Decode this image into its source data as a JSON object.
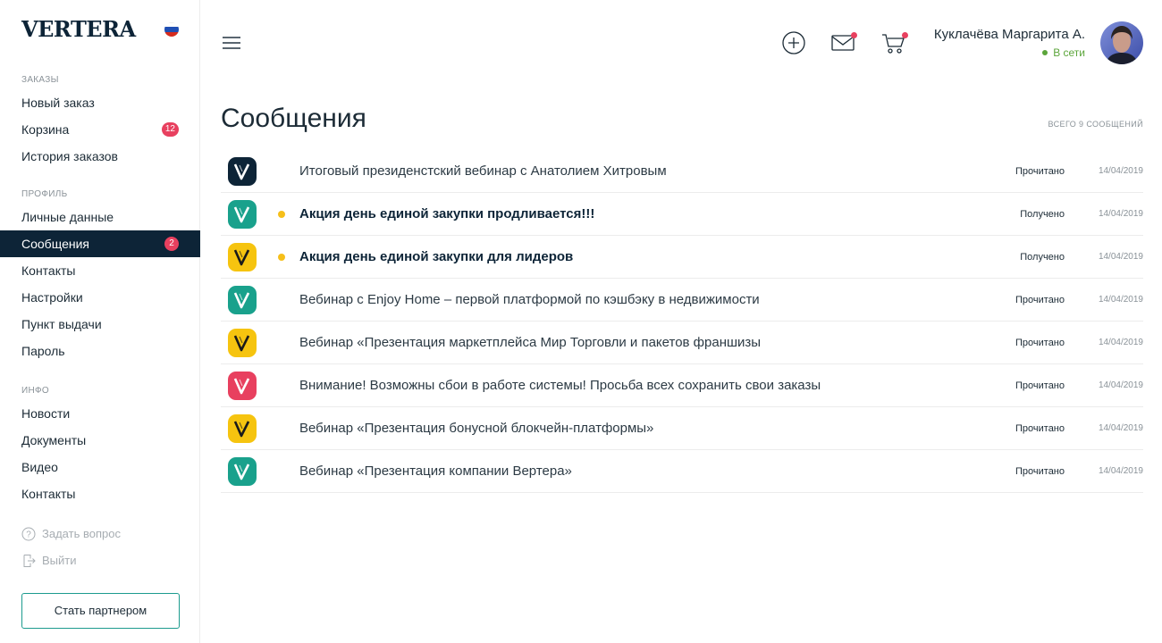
{
  "brand": {
    "logo": "VERTERA"
  },
  "sidebar": {
    "sections": [
      {
        "title": "ЗАКАЗЫ",
        "items": [
          {
            "label": "Новый заказ"
          },
          {
            "label": "Корзина",
            "badge": "12"
          },
          {
            "label": "История заказов"
          }
        ]
      },
      {
        "title": "ПРОФИЛЬ",
        "items": [
          {
            "label": "Личные данные"
          },
          {
            "label": "Сообщения",
            "badge": "2",
            "active": true
          },
          {
            "label": "Контакты"
          },
          {
            "label": "Настройки"
          },
          {
            "label": "Пункт выдачи"
          },
          {
            "label": "Пароль"
          }
        ]
      },
      {
        "title": "ИНФО",
        "items": [
          {
            "label": "Новости"
          },
          {
            "label": "Документы"
          },
          {
            "label": "Видео"
          },
          {
            "label": "Контакты"
          }
        ]
      }
    ],
    "ask_question": "Задать вопрос",
    "logout": "Выйти",
    "partner_button": "Стать партнером"
  },
  "header": {
    "user_name": "Куклачёва Маргарита А.",
    "user_status": "В сети",
    "icons": [
      "add-icon",
      "mail-icon",
      "cart-icon"
    ]
  },
  "main": {
    "title": "Сообщения",
    "total": "ВСЕГО 9 СООБЩЕНИЙ",
    "messages": [
      {
        "title": "Итоговый президенстский вебинар с Анатолием Хитровым",
        "status": "Прочитано",
        "date": "14/04/2019",
        "unread": false,
        "logo_color": "#0d2437"
      },
      {
        "title": "Акция день единой закупки продливается!!!",
        "status": "Получено",
        "date": "14/04/2019",
        "unread": true,
        "logo_color": "#19a18c"
      },
      {
        "title": "Акция день единой закупки для лидеров",
        "status": "Получено",
        "date": "14/04/2019",
        "unread": true,
        "logo_color": "#f6c40f"
      },
      {
        "title": "Вебинар с Enjoy Home – первой платформой по кэшбэку в недвижимости",
        "status": "Прочитано",
        "date": "14/04/2019",
        "unread": false,
        "logo_color": "#19a18c"
      },
      {
        "title": "Вебинар «Презентация маркетплейса Мир Торговли и пакетов франшизы",
        "status": "Прочитано",
        "date": "14/04/2019",
        "unread": false,
        "logo_color": "#f6c40f"
      },
      {
        "title": "Внимание! Возможны сбои в работе системы! Просьба всех сохранить свои заказы",
        "status": "Прочитано",
        "date": "14/04/2019",
        "unread": false,
        "logo_color": "#e8405f"
      },
      {
        "title": "Вебинар «Презентация бонусной блокчейн-платформы»",
        "status": "Прочитано",
        "date": "14/04/2019",
        "unread": false,
        "logo_color": "#f6c40f"
      },
      {
        "title": "Вебинар «Презентация компании Вертера»",
        "status": "Прочитано",
        "date": "14/04/2019",
        "unread": false,
        "logo_color": "#19a18c"
      }
    ]
  },
  "colors": {
    "brand_dark": "#0d2437",
    "badge": "#e8405f",
    "online": "#5ba53a",
    "unread_dot": "#f6bf1a",
    "partner_border": "#1c9b8e"
  }
}
